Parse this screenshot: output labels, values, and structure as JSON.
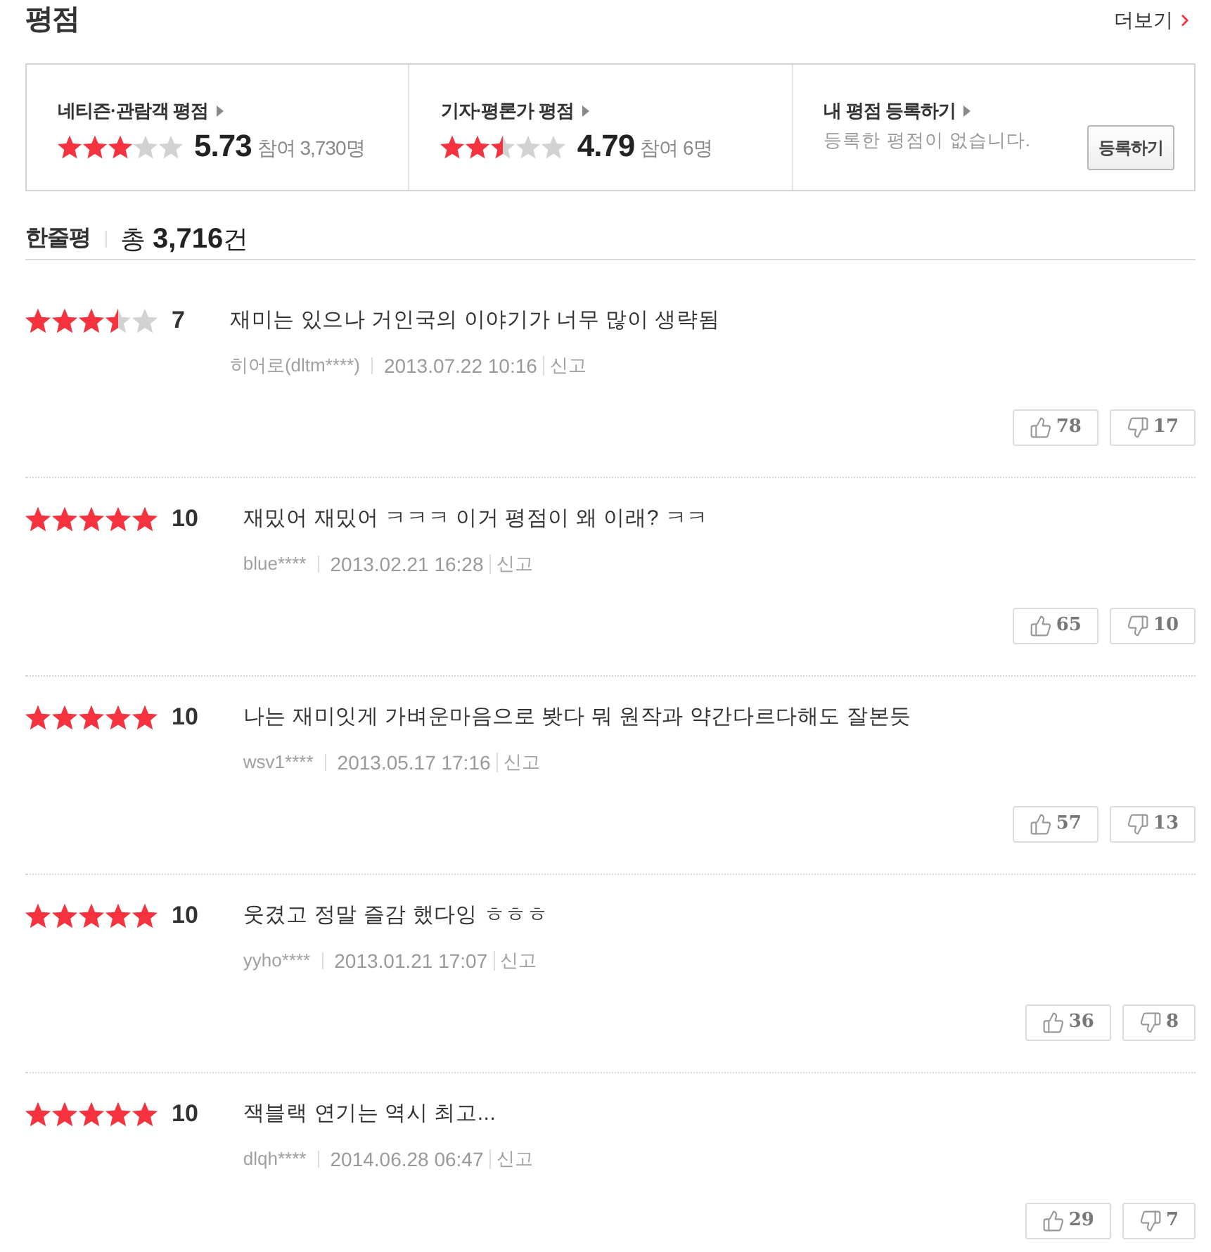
{
  "header": {
    "title": "평점",
    "more_link": "더보기"
  },
  "summary": [
    {
      "kind": "rating",
      "title": "네티즌·관람객 평점",
      "stars": 3,
      "score": "5.73",
      "participants": "참여 3,730명"
    },
    {
      "kind": "rating",
      "title": "기자·평론가 평점",
      "stars": 2.5,
      "score": "4.79",
      "participants": "참여 6명"
    },
    {
      "kind": "register",
      "title": "내 평점 등록하기",
      "message": "등록한 평점이 없습니다.",
      "button": "등록하기"
    }
  ],
  "comments_header": {
    "title": "한줄평",
    "total": "총 **3,716**건"
  },
  "reviews": [
    {
      "stars": 3.5,
      "score": "7",
      "text": "재미는 있으나 거인국의 이야기가 너무 많이 생략됨",
      "author": "히어로(dltm****)",
      "date": "2013.07.22 10:16",
      "report": "신고",
      "likes": "78",
      "dislikes": "17"
    },
    {
      "stars": 5,
      "score": "10",
      "text": "재밌어 재밌어 ㅋㅋㅋ 이거 평점이 왜 이래? ㅋㅋ",
      "author": "blue****",
      "date": "2013.02.21 16:28",
      "report": "신고",
      "likes": "65",
      "dislikes": "10"
    },
    {
      "stars": 5,
      "score": "10",
      "text": "나는 재미잇게 가벼운마음으로 봣다 뭐 원작과 약간다르다해도 잘본듯",
      "author": "wsv1****",
      "date": "2013.05.17 17:16",
      "report": "신고",
      "likes": "57",
      "dislikes": "13"
    },
    {
      "stars": 5,
      "score": "10",
      "text": "웃겼고 정말 즐감 했다잉 ㅎㅎㅎ",
      "author": "yyho****",
      "date": "2013.01.21 17:07",
      "report": "신고",
      "likes": "36",
      "dislikes": "8"
    },
    {
      "stars": 5,
      "score": "10",
      "text": "잭블랙 연기는 역시 최고...",
      "author": "dlqh****",
      "date": "2014.06.28 06:47",
      "report": "신고",
      "likes": "29",
      "dislikes": "7"
    }
  ]
}
